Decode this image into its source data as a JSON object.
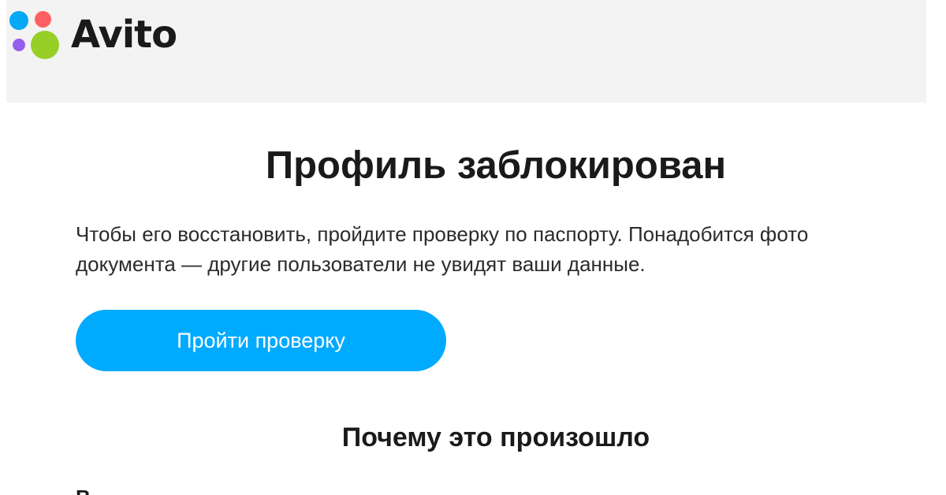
{
  "header": {
    "logo_text": "Avito",
    "logo_colors": {
      "blue": "#04a8f5",
      "red": "#ff6163",
      "purple": "#965eeb",
      "green": "#97cf26"
    }
  },
  "main": {
    "title": "Профиль заблокирован",
    "description": "Чтобы его восстановить, пройдите проверку по паспорту. Понадобится фото документа — другие пользователи не увидят ваши данные.",
    "cta_label": "Пройти проверку",
    "cta_color": "#00aaff",
    "subtitle": "Почему это произошло",
    "cut_text": "В"
  }
}
